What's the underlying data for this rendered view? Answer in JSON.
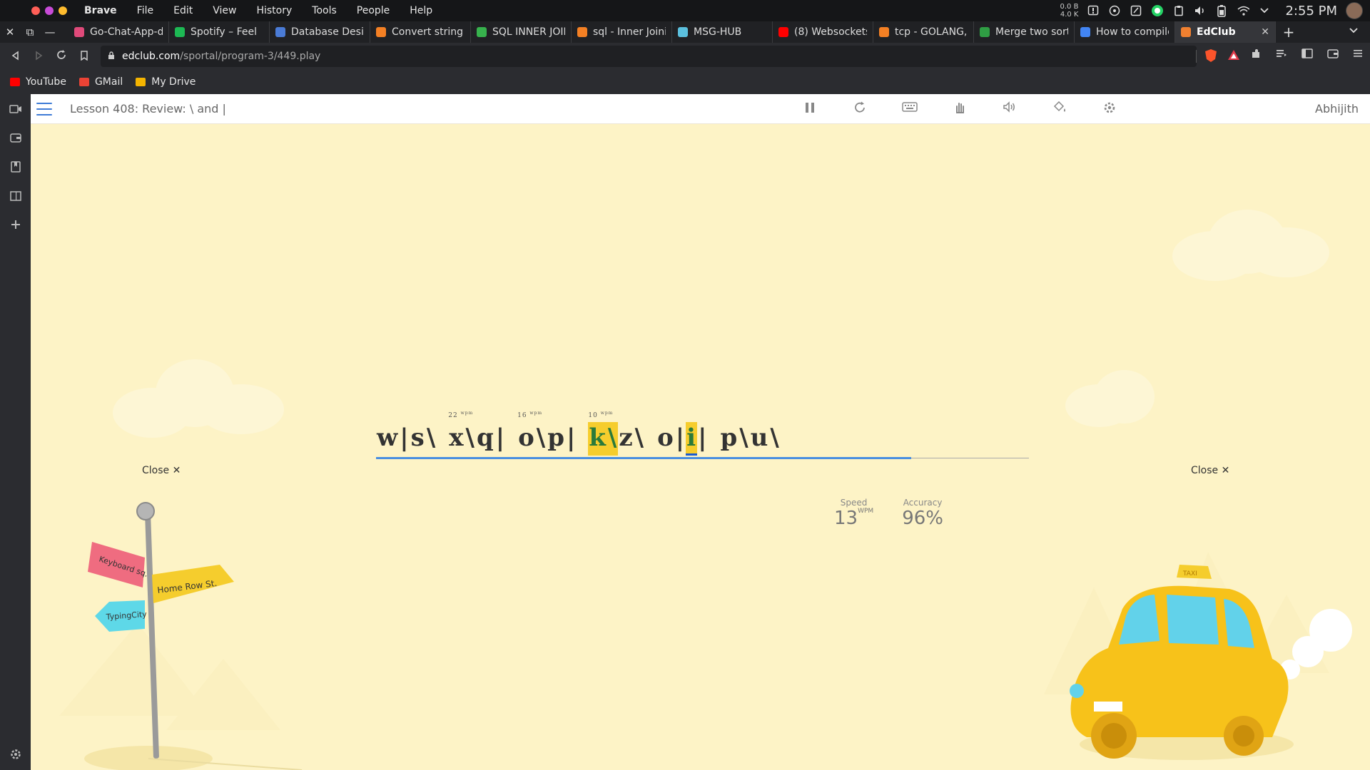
{
  "system": {
    "menu": [
      "Brave",
      "File",
      "Edit",
      "View",
      "History",
      "Tools",
      "People",
      "Help"
    ],
    "net_up": "0.0 B",
    "net_down": "4.0 K",
    "time": "2:55 PM"
  },
  "tabs": [
    {
      "title": "Go-Chat-App-d",
      "color": "#e04a7a"
    },
    {
      "title": "Spotify – Feel",
      "color": "#1db954"
    },
    {
      "title": "Database Desig",
      "color": "#4a7bd6"
    },
    {
      "title": "Convert string t",
      "color": "#f48024"
    },
    {
      "title": "SQL INNER JOIN",
      "color": "#37b24d"
    },
    {
      "title": "sql - Inner Joini",
      "color": "#f48024"
    },
    {
      "title": "MSG-HUB",
      "color": "#5bc0de"
    },
    {
      "title": "(8) Websockets",
      "color": "#ff0000"
    },
    {
      "title": "tcp - GOLANG, H",
      "color": "#f48024"
    },
    {
      "title": "Merge two sort",
      "color": "#2f9e44"
    },
    {
      "title": "How to compile",
      "color": "#4285f4"
    },
    {
      "title": "EdClub",
      "color": "#f08030",
      "active": true
    }
  ],
  "address": {
    "domain": "edclub.com",
    "path": "/sportal/program-3/449.play"
  },
  "bookmarks": [
    {
      "label": "YouTube",
      "color": "#ff0000"
    },
    {
      "label": "GMail",
      "color": "#ea4335"
    },
    {
      "label": "My Drive",
      "color": "#f4b400"
    }
  ],
  "app": {
    "lesson_title": "Lesson 408: Review: \\ and |",
    "user_name": "Abhijith",
    "close_left": "Close ✕",
    "close_right": "Close ✕",
    "progress": 0.82,
    "words": [
      {
        "text": "w|s\\"
      },
      {
        "text": "x\\q|",
        "wpm": "22"
      },
      {
        "text": "o\\p|",
        "wpm": "16"
      },
      {
        "text": "k\\z\\",
        "wpm": "10"
      },
      {
        "text": "o|i|"
      },
      {
        "text": "p\\u\\"
      }
    ],
    "wpm_unit": "wpm",
    "stats": {
      "speed_label": "Speed",
      "speed_value": "13",
      "speed_unit": "WPM",
      "accuracy_label": "Accuracy",
      "accuracy_value": "96%"
    },
    "signs": {
      "keyboard": "Keyboard sq.",
      "homerow": "Home Row St.",
      "typingcity": "TypingCity"
    },
    "taxi_label": "TAXI"
  }
}
